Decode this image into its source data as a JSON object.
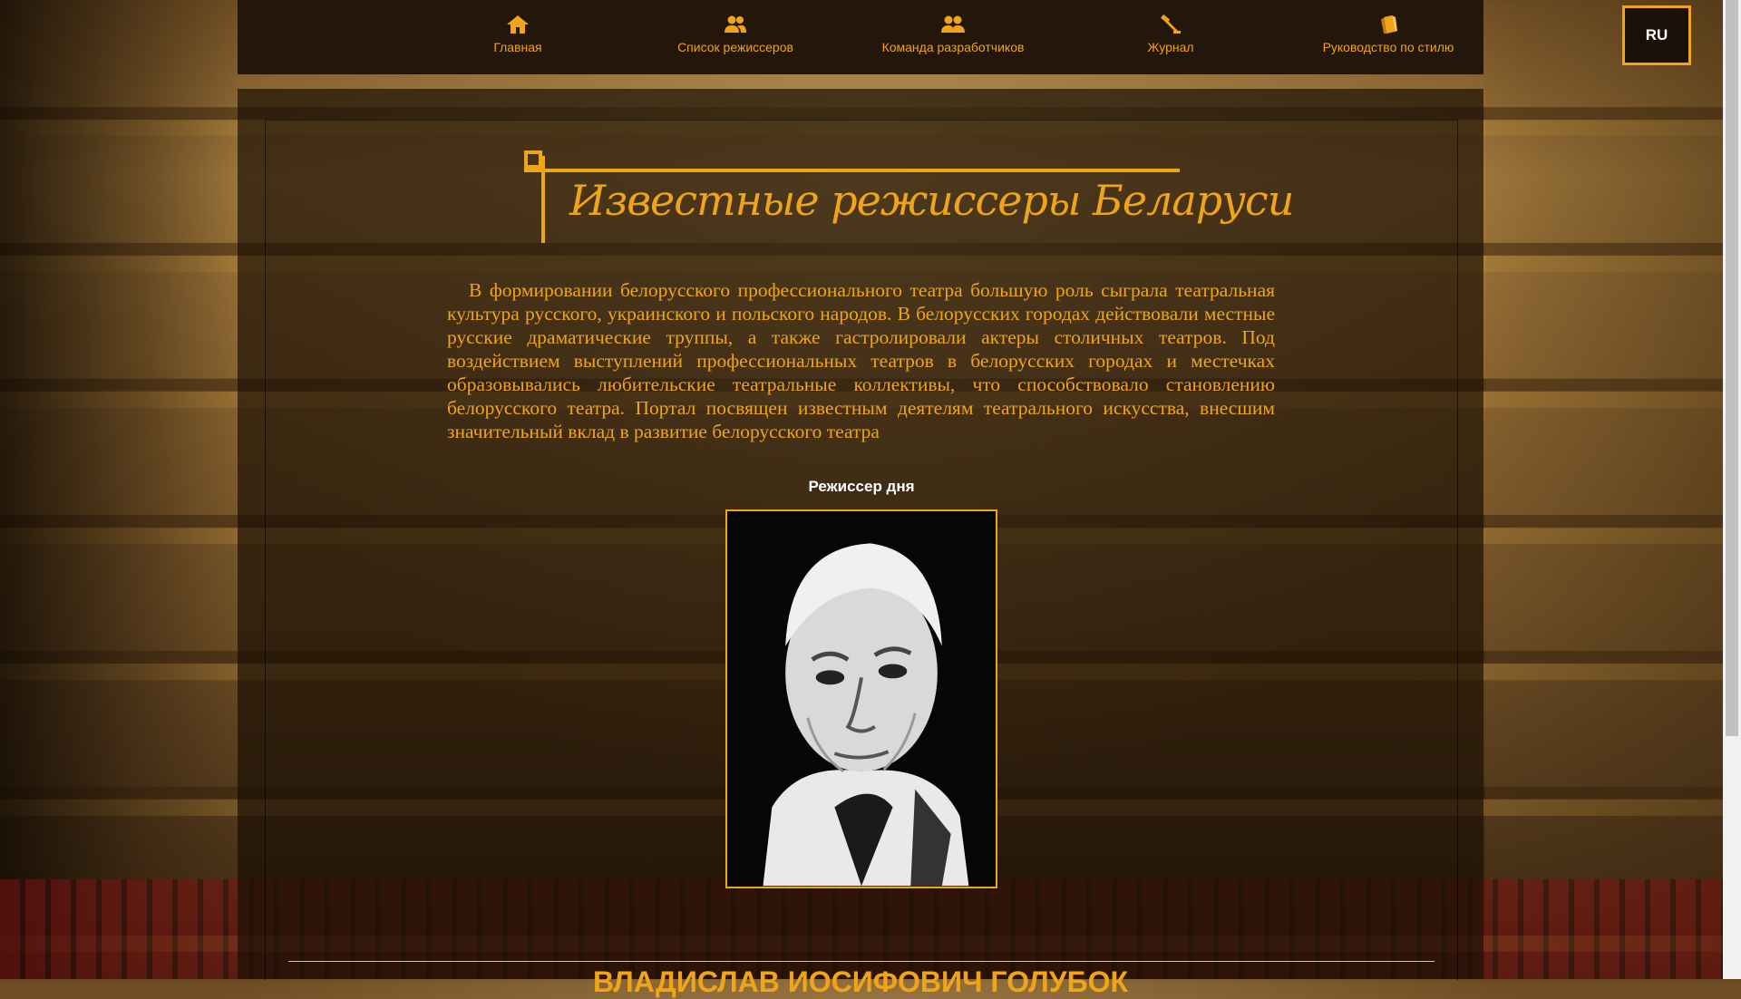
{
  "nav": {
    "items": [
      {
        "label": "Главная",
        "icon": "home-icon"
      },
      {
        "label": "Список режиссеров",
        "icon": "people-icon"
      },
      {
        "label": "Команда разработчиков",
        "icon": "team-icon"
      },
      {
        "label": "Журнал",
        "icon": "hammer-icon"
      },
      {
        "label": "Руководство по стилю",
        "icon": "book-icon"
      }
    ],
    "language": "RU"
  },
  "main": {
    "title": "Известные режиссеры Беларуси",
    "intro": "В формировании белорусского профессионального театра большую роль сыграла театральная культура русского, украинского и польского народов. В белорусских городах действовали местные русские драматические труппы, а также гастролировали актеры столичных театров. Под воздействием выступлений профессиональных театров в белорусских городах и местечках образовывались любительские театральные коллективы, что способствовало становлению белорусского театра. Портал посвящен известным деятелям театрального искусства, внесшим значительный вклад в развитие белорусского театра",
    "director_of_day_label": "Режиссер дня",
    "director_name": "ВЛАДИСЛАВ ИОСИФОВИЧ ГОЛУБОК"
  },
  "colors": {
    "accent": "#f0a418",
    "navbar_bg": "#23160a",
    "panel_bg": "#1e1206"
  }
}
